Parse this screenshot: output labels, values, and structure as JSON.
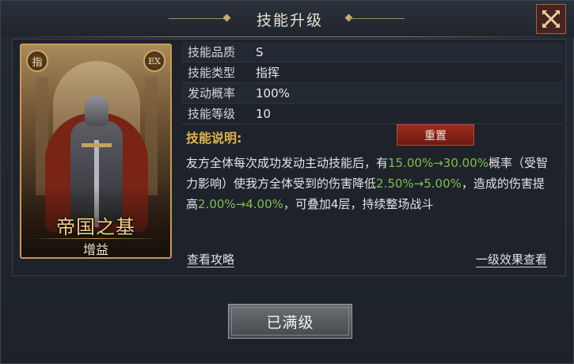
{
  "window": {
    "title": "技能升级"
  },
  "card": {
    "badge_left": "指",
    "badge_right": "EX",
    "name": "帝国之基",
    "tag": "增益"
  },
  "info": {
    "rows": [
      {
        "label": "技能品质",
        "value": "S"
      },
      {
        "label": "技能类型",
        "value": "指挥"
      },
      {
        "label": "发动概率",
        "value": "100%"
      },
      {
        "label": "技能等级",
        "value": "10"
      }
    ]
  },
  "description": {
    "heading": "技能说明:",
    "reset_label": "重置",
    "segments": [
      {
        "text": "友方全体每次成功发动主动技能后，有",
        "highlight": false
      },
      {
        "text": "15.00%→30.00%",
        "highlight": true
      },
      {
        "text": "概率（受智力影响）使我方全体受到的伤害降低",
        "highlight": false
      },
      {
        "text": "2.50%→5.00%",
        "highlight": true
      },
      {
        "text": "，造成的伤害提高",
        "highlight": false
      },
      {
        "text": "2.00%→4.00%",
        "highlight": true
      },
      {
        "text": "，可叠加4层，持续整场战斗",
        "highlight": false
      }
    ],
    "highlight_color": "#7fbf4d"
  },
  "links": {
    "view_guide": "查看攻略",
    "level_one_effect": "一级效果查看"
  },
  "footer": {
    "maxed_label": "已满级"
  },
  "icons": {
    "close": "close-icon"
  }
}
